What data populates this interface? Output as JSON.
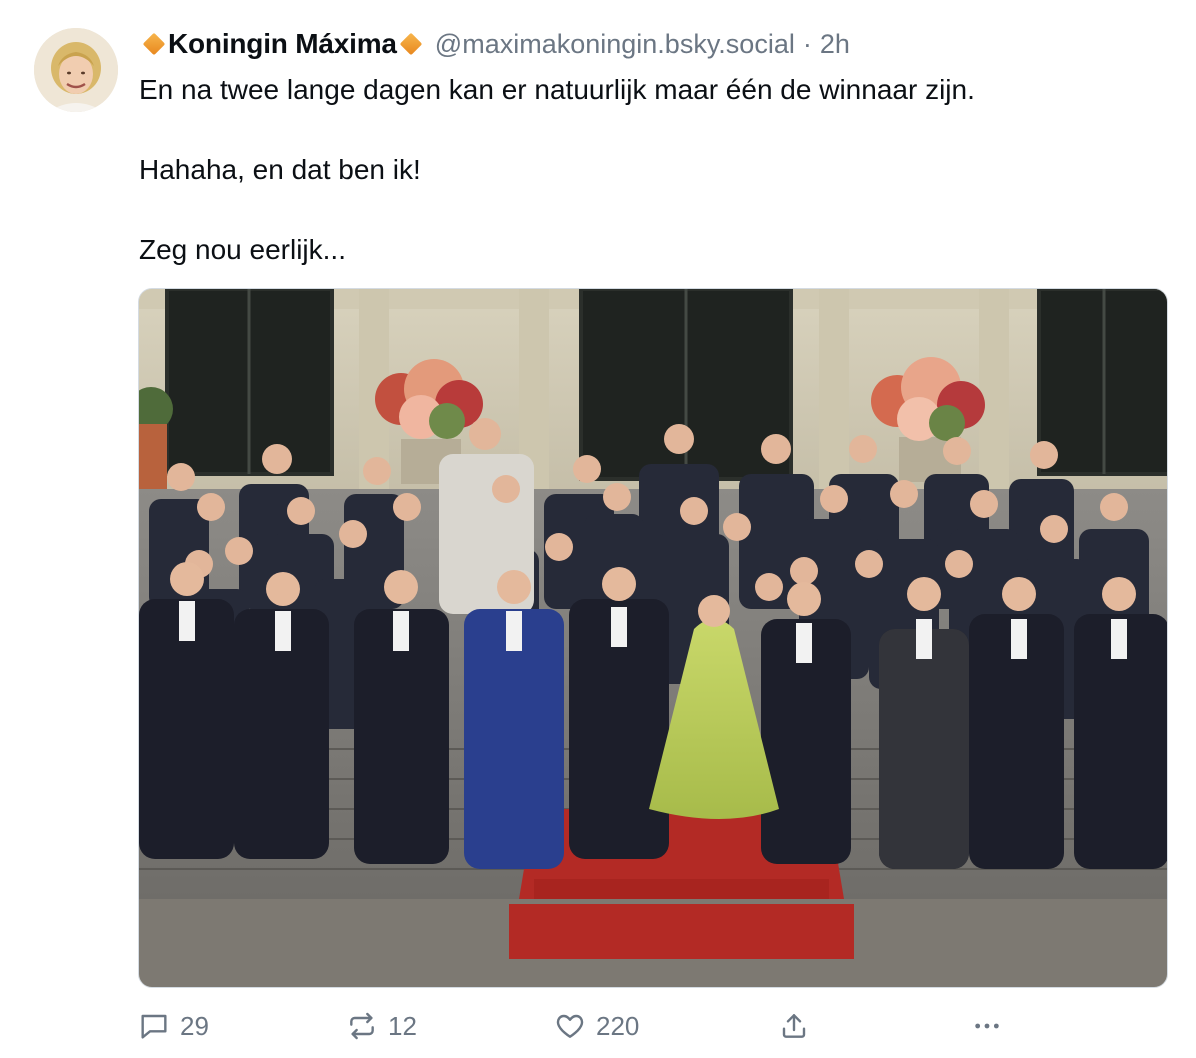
{
  "author": {
    "display_name": "Koningin Máxima",
    "handle": "@maximakoningin.bsky.social",
    "separator": "·",
    "time_ago": "2h",
    "badge_color": "#f2a23a",
    "avatar_icon": "profile-photo"
  },
  "post": {
    "lines": [
      "En na twee lange dagen kan er natuurlijk maar één de winnaar zijn.",
      "Hahaha, en dat ben ik!",
      "Zeg nou eerlijk..."
    ]
  },
  "media": {
    "type": "photo"
  },
  "actions": {
    "reply_count": "29",
    "repost_count": "12",
    "like_count": "220",
    "reply_icon": "speech-bubble-icon",
    "repost_icon": "repost-arrows-icon",
    "like_icon": "heart-icon",
    "share_icon": "share-upload-icon",
    "more_icon": "ellipsis-icon",
    "icon_color": "#6b7683"
  }
}
